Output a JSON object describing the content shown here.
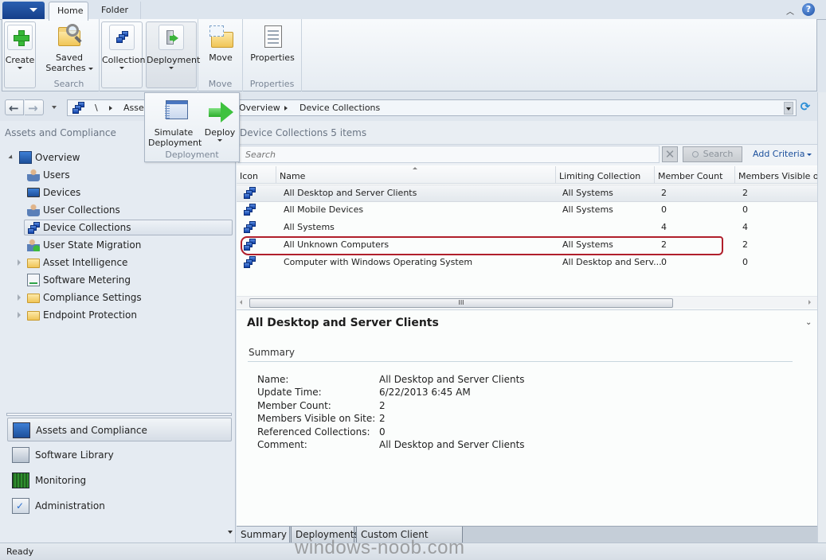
{
  "tabstrip": {
    "tabs": [
      {
        "label": "Home",
        "active": true
      },
      {
        "label": "Folder",
        "active": false
      }
    ],
    "minimize_icon": "chevron-up-icon",
    "help_icon": "help-icon",
    "help_glyph": "?"
  },
  "ribbon": {
    "groups": [
      {
        "label": "",
        "buttons": [
          {
            "label": "Create",
            "icon": "plus-icon",
            "dropdown": true
          }
        ]
      },
      {
        "label": "Search",
        "buttons": [
          {
            "label_line1": "Saved",
            "label_line2": "Searches",
            "icon": "saved-searches-icon",
            "dropdown": true
          }
        ]
      },
      {
        "label": "",
        "buttons": [
          {
            "label": "Collection",
            "icon": "collection-icon",
            "dropdown": true
          }
        ]
      },
      {
        "label": "",
        "buttons": [
          {
            "label": "Deployment",
            "icon": "deployment-icon",
            "dropdown": true
          }
        ]
      },
      {
        "label": "Move",
        "buttons": [
          {
            "label": "Move",
            "icon": "move-folder-icon"
          }
        ]
      },
      {
        "label": "Properties",
        "buttons": [
          {
            "label": "Properties",
            "icon": "properties-icon"
          }
        ]
      }
    ]
  },
  "flyout": {
    "group_label": "Deployment",
    "buttons": [
      {
        "label_line1": "Simulate",
        "label_line2": "Deployment",
        "icon": "simulate-deployment-icon"
      },
      {
        "label": "Deploy",
        "icon": "deploy-arrow-icon",
        "dropdown": true
      }
    ]
  },
  "navigation": {
    "back_glyph": "🡐",
    "forward_glyph": "🡒",
    "breadcrumb": [
      "\\",
      "Assets and Compliance",
      "Overview",
      "Device Collections"
    ],
    "breadcrumb_visible_partial": "Asset",
    "refresh_glyph": "⟳"
  },
  "left_pane": {
    "title": "Assets and Compliance",
    "tree": [
      {
        "label": "Overview",
        "icon": "overview-icon",
        "expanded": true,
        "level": 0
      },
      {
        "label": "Users",
        "icon": "users-icon",
        "level": 1
      },
      {
        "label": "Devices",
        "icon": "devices-icon",
        "level": 1
      },
      {
        "label": "User Collections",
        "icon": "user-collections-icon",
        "level": 1
      },
      {
        "label": "Device Collections",
        "icon": "device-collections-icon",
        "level": 1,
        "selected": true
      },
      {
        "label": "User State Migration",
        "icon": "user-state-migration-icon",
        "level": 1
      },
      {
        "label": "Asset Intelligence",
        "icon": "folder-icon",
        "level": 1,
        "expandable": true
      },
      {
        "label": "Software Metering",
        "icon": "software-metering-icon",
        "level": 1
      },
      {
        "label": "Compliance Settings",
        "icon": "folder-icon",
        "level": 1,
        "expandable": true
      },
      {
        "label": "Endpoint Protection",
        "icon": "folder-icon",
        "level": 1,
        "expandable": true
      }
    ],
    "workspaces": [
      {
        "label": "Assets and Compliance",
        "icon": "assets-compliance-icon",
        "selected": true
      },
      {
        "label": "Software Library",
        "icon": "software-library-icon"
      },
      {
        "label": "Monitoring",
        "icon": "monitoring-icon"
      },
      {
        "label": "Administration",
        "icon": "administration-icon"
      }
    ]
  },
  "main": {
    "title": "Device Collections",
    "item_count": "5 items",
    "search": {
      "placeholder": "Search",
      "clear_glyph": "✕",
      "button_label": "Search",
      "add_criteria_label": "Add Criteria"
    },
    "columns": [
      "Icon",
      "Name",
      "Limiting Collection",
      "Member Count",
      "Members Visible on Site"
    ],
    "rows": [
      {
        "name": "All Desktop and Server Clients",
        "limiting": "All Systems",
        "member_count": "2",
        "visible": "2",
        "selected": true
      },
      {
        "name": "All Mobile Devices",
        "limiting": "All Systems",
        "member_count": "0",
        "visible": "0"
      },
      {
        "name": "All Systems",
        "limiting": "",
        "member_count": "4",
        "visible": "4"
      },
      {
        "name": "All Unknown Computers",
        "limiting": "All Systems",
        "member_count": "2",
        "visible": "2",
        "highlighted": true
      },
      {
        "name": "Computer with Windows Operating System",
        "limiting": "All Desktop and Serv...",
        "member_count": "0",
        "visible": "0"
      }
    ],
    "scroll_grip": "III"
  },
  "details": {
    "title": "All Desktop and Server Clients",
    "collapse_glyph": "⌄",
    "section": "Summary",
    "fields": [
      {
        "key": "Name:",
        "value": "All Desktop and Server Clients"
      },
      {
        "key": "Update Time:",
        "value": "6/22/2013 6:45 AM"
      },
      {
        "key": "Member Count:",
        "value": "2"
      },
      {
        "key": "Members Visible on Site:",
        "value": "2"
      },
      {
        "key": "Referenced Collections:",
        "value": "0"
      },
      {
        "key": "Comment:",
        "value": "All Desktop and Server Clients"
      }
    ],
    "tabs": [
      {
        "label": "Summary",
        "active": true
      },
      {
        "label": "Deployments",
        "active": false
      },
      {
        "label": "Custom Client Settings",
        "active": false
      }
    ]
  },
  "status": {
    "text": "Ready",
    "watermark": "windows-noob.com"
  },
  "colors": {
    "highlight_ring": "#b01f2b",
    "accent_blue": "#1b4f9c",
    "app_menu": "#1f4f9f"
  }
}
